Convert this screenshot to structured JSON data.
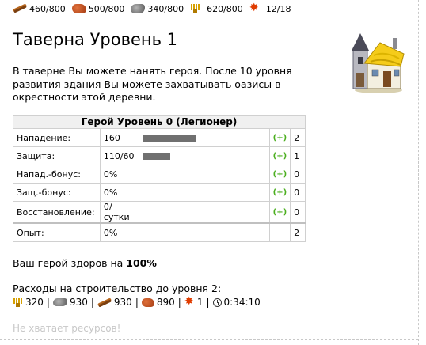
{
  "resources": [
    {
      "icon": "wood-icon",
      "value": "460/800"
    },
    {
      "icon": "clay-icon",
      "value": "500/800"
    },
    {
      "icon": "iron-icon",
      "value": "340/800"
    },
    {
      "icon": "crop-icon",
      "value": "620/800"
    },
    {
      "icon": "consumption-icon",
      "value": "12/18"
    }
  ],
  "title": "Таверна Уровень 1",
  "description": "В таверне Вы можете нанять героя. После 10 уровня развития здания Вы можете захватывать оазисы в окрестности этой деревни.",
  "hero_table": {
    "header": "Герой Уровень 0 (Легионер)",
    "rows": [
      {
        "label": "Нападение:",
        "value": "160",
        "bar_fraction": 0.45,
        "plus": "(+)",
        "points": "2"
      },
      {
        "label": "Защита:",
        "value": "110/60",
        "bar_fraction": 0.23,
        "plus": "(+)",
        "points": "1"
      },
      {
        "label": "Напад.-бонус:",
        "value": "0%",
        "bar_fraction": 0,
        "plus": "(+)",
        "points": "0"
      },
      {
        "label": "Защ.-бонус:",
        "value": "0%",
        "bar_fraction": 0,
        "plus": "(+)",
        "points": "0"
      },
      {
        "label": "Восстановление:",
        "value": "0/сутки",
        "bar_fraction": 0,
        "plus": "(+)",
        "points": "0"
      },
      {
        "label": "Опыт:",
        "value": "0%",
        "bar_fraction": 0,
        "plus": "",
        "points": "2"
      }
    ]
  },
  "health": {
    "prefix": "Ваш герой здоров на ",
    "value": "100%"
  },
  "cost": {
    "title": "Расходы на строительство до уровня 2:",
    "items": [
      {
        "icon": "crop-icon",
        "value": "320"
      },
      {
        "icon": "iron-icon",
        "value": "930"
      },
      {
        "icon": "wood-icon",
        "value": "930"
      },
      {
        "icon": "clay-icon",
        "value": "890"
      },
      {
        "icon": "consumption-icon",
        "value": "1"
      },
      {
        "icon": "clock-icon",
        "value": "0:34:10"
      }
    ],
    "separator": "|"
  },
  "warning": "Не хватает ресурсов!"
}
